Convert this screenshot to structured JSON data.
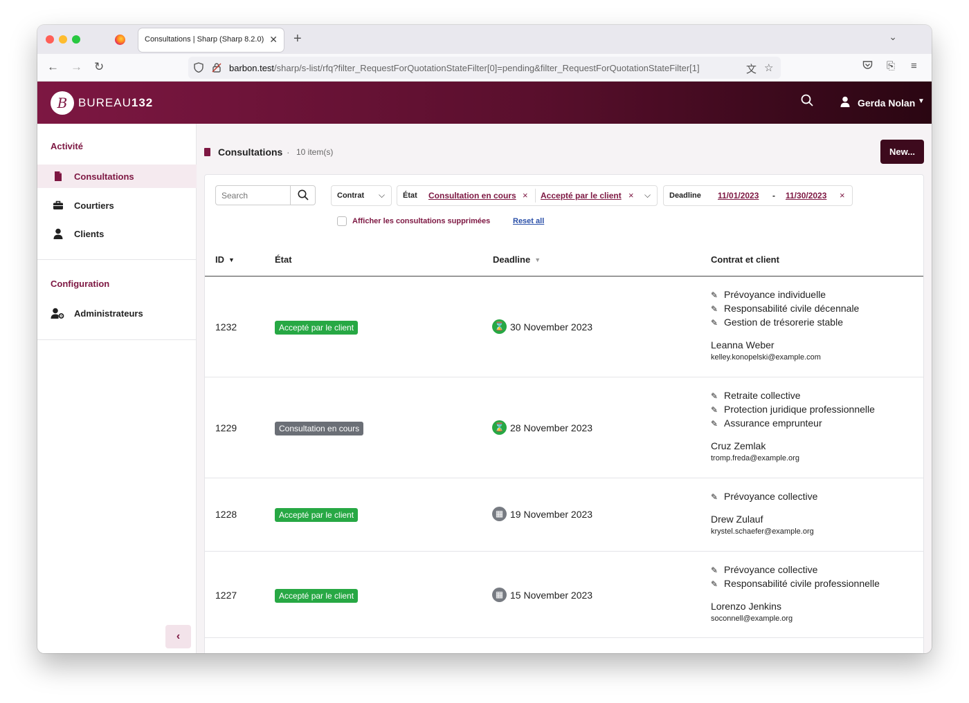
{
  "browser": {
    "tab_title": "Consultations | Sharp (Sharp 8.2.0)",
    "url_host": "barbon.test",
    "url_path": "/sharp/s-list/rfq?filter_RequestForQuotationStateFilter[0]=pending&filter_RequestForQuotationStateFilter[1]"
  },
  "header": {
    "logo_letter": "B",
    "brand_light": "BUREAU",
    "brand_bold": "132",
    "user_name": "Gerda Nolan"
  },
  "sidebar": {
    "section1": "Activité",
    "items1": [
      {
        "label": "Consultations",
        "icon": "file-icon",
        "active": true
      },
      {
        "label": "Courtiers",
        "icon": "briefcase-icon",
        "active": false
      },
      {
        "label": "Clients",
        "icon": "user-icon",
        "active": false
      }
    ],
    "section2": "Configuration",
    "items2": [
      {
        "label": "Administrateurs",
        "icon": "user-cog-icon",
        "active": false
      }
    ],
    "collapse_glyph": "‹"
  },
  "page": {
    "title": "Consultations",
    "separator": "·",
    "count": "10 item(s)",
    "new_button": "New..."
  },
  "filters": {
    "search_placeholder": "Search",
    "contrat_label": "Contrat",
    "etat_label": "État",
    "etat_values": [
      "Consultation en cours",
      "Accepté par le client"
    ],
    "deadline_label": "Deadline",
    "deadline_from": "11/01/2023",
    "deadline_to": "11/30/2023",
    "show_deleted_label": "Afficher les consultations supprimées",
    "reset_all": "Reset all"
  },
  "table": {
    "headers": {
      "id": "ID",
      "state": "État",
      "deadline": "Deadline",
      "contract": "Contrat et client"
    },
    "rows": [
      {
        "id": "1232",
        "state": "Accepté par le client",
        "state_color": "#27a844",
        "deadline_icon": "hourglass-icon",
        "deadline": "30 November 2023",
        "contracts": [
          "Prévoyance individuelle",
          "Responsabilité civile décennale",
          "Gestion de trésorerie stable"
        ],
        "client_name": "Leanna Weber",
        "client_email": "kelley.konopelski@example.com"
      },
      {
        "id": "1229",
        "state": "Consultation en cours",
        "state_color": "#6b6f76",
        "deadline_icon": "hourglass-icon",
        "deadline": "28 November 2023",
        "contracts": [
          "Retraite collective",
          "Protection juridique professionnelle",
          "Assurance emprunteur"
        ],
        "client_name": "Cruz Zemlak",
        "client_email": "tromp.freda@example.org"
      },
      {
        "id": "1228",
        "state": "Accepté par le client",
        "state_color": "#27a844",
        "deadline_icon": "calendar-icon",
        "deadline": "19 November 2023",
        "contracts": [
          "Prévoyance collective"
        ],
        "client_name": "Drew Zulauf",
        "client_email": "krystel.schaefer@example.org"
      },
      {
        "id": "1227",
        "state": "Accepté par le client",
        "state_color": "#27a844",
        "deadline_icon": "calendar-icon",
        "deadline": "15 November 2023",
        "contracts": [
          "Prévoyance collective",
          "Responsabilité civile professionnelle"
        ],
        "client_name": "Lorenzo Jenkins",
        "client_email": "soconnell@example.org"
      }
    ]
  },
  "colors": {
    "brand": "#7d1742",
    "brand_dark": "#3d0a1d",
    "success": "#27a844",
    "neutral": "#6b6f76"
  }
}
